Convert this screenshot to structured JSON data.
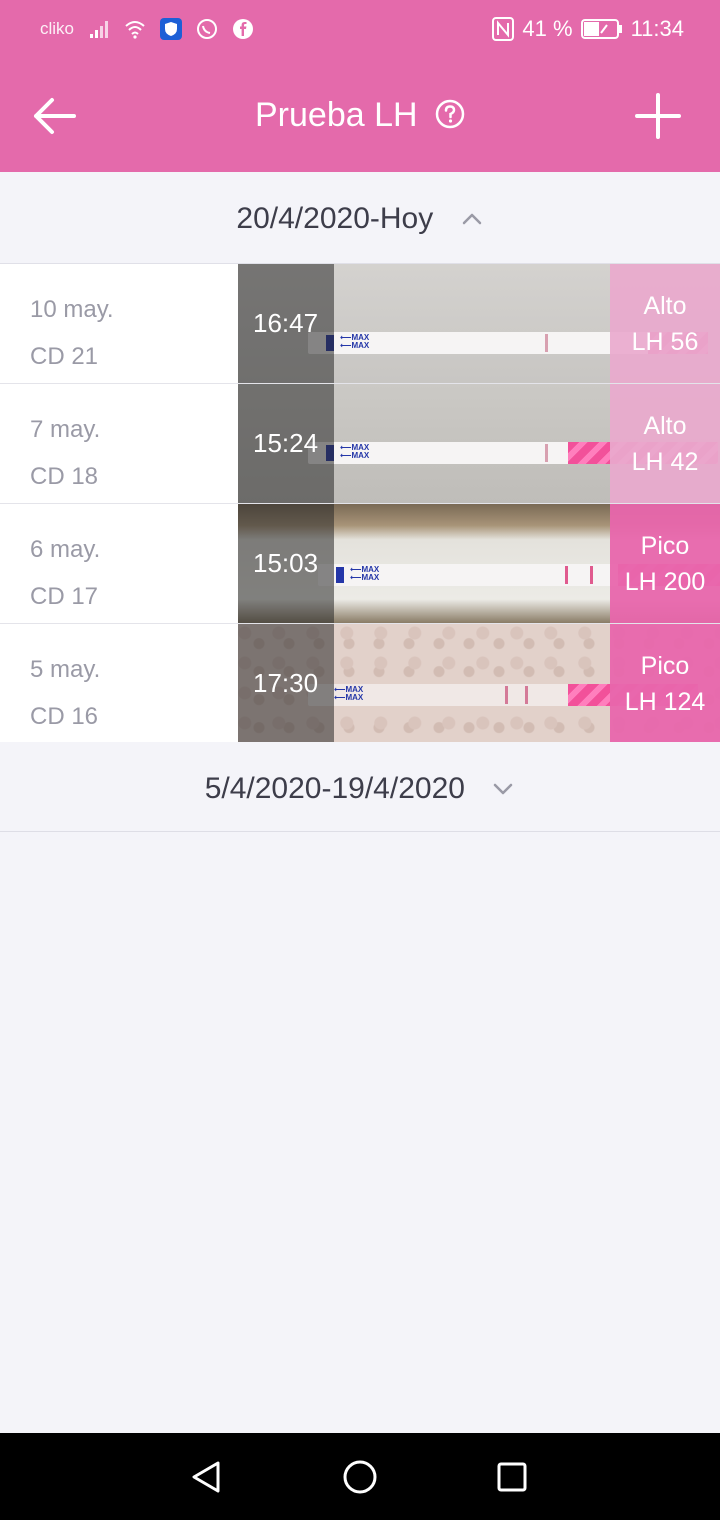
{
  "status_bar": {
    "carrier": "cliko",
    "icons": [
      "signal-icon",
      "wifi-icon",
      "shield-app-icon",
      "whatsapp-icon",
      "facebook-icon"
    ],
    "nfc_icon": "nfc-icon",
    "battery_percent": "41 %",
    "time": "11:34"
  },
  "app_bar": {
    "title": "Prueba LH",
    "back_icon": "arrow-left-icon",
    "help_icon": "question-circle-icon",
    "add_icon": "plus-icon",
    "color": "#e46aab"
  },
  "sections": [
    {
      "label": "20/4/2020-Hoy",
      "expanded": true,
      "chevron": "chevron-up-icon"
    },
    {
      "label": "5/4/2020-19/4/2020",
      "expanded": false,
      "chevron": "chevron-down-icon"
    }
  ],
  "tests": [
    {
      "date": "10 may.",
      "cycle_day": "CD 21",
      "time": "16:47",
      "result": "Alto",
      "lh": "LH 56",
      "result_color": "#e9a9cd"
    },
    {
      "date": "7 may.",
      "cycle_day": "CD 18",
      "time": "15:24",
      "result": "Alto",
      "lh": "LH 42",
      "result_color": "#e9a9cd"
    },
    {
      "date": "6 may.",
      "cycle_day": "CD 17",
      "time": "15:03",
      "result": "Pico",
      "lh": "LH 200",
      "result_color": "#e866ac"
    },
    {
      "date": "5 may.",
      "cycle_day": "CD 16",
      "time": "17:30",
      "result": "Pico",
      "lh": "LH 124",
      "result_color": "#e866ac"
    }
  ],
  "nav": {
    "back": "nav-back-icon",
    "home": "nav-home-icon",
    "recents": "nav-recents-icon"
  }
}
